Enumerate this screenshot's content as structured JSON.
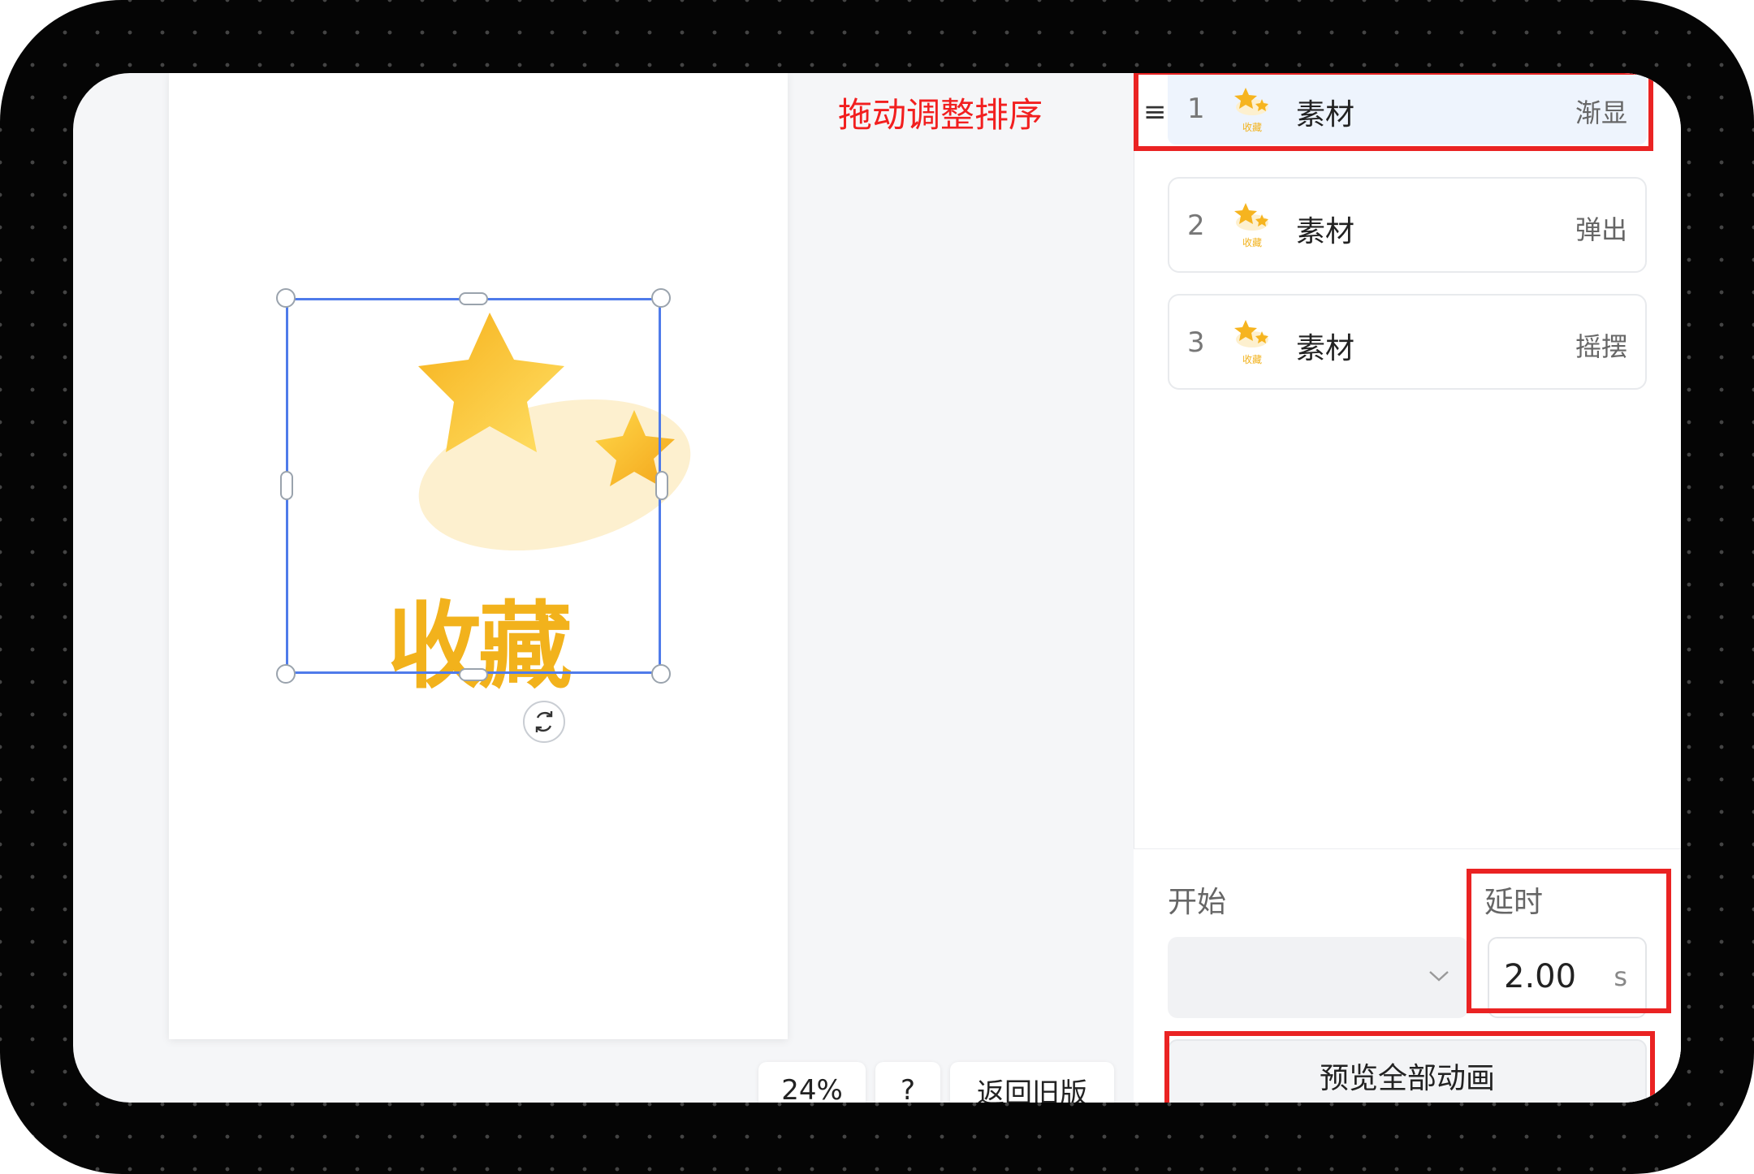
{
  "canvas": {
    "sticker_text": "收藏",
    "drag_hint": "拖动调整排序"
  },
  "toolbar": {
    "zoom": "24%",
    "help": "?",
    "back_old": "返回旧版"
  },
  "panel": {
    "items": [
      {
        "index": "1",
        "name": "素材",
        "animation": "渐显",
        "thumb_label": "收藏"
      },
      {
        "index": "2",
        "name": "素材",
        "animation": "弹出",
        "thumb_label": "收藏"
      },
      {
        "index": "3",
        "name": "素材",
        "animation": "摇摆",
        "thumb_label": "收藏"
      }
    ],
    "start_label": "开始",
    "delay_label": "延时",
    "delay_value": "2.00",
    "delay_unit": "s",
    "preview_label": "预览全部动画"
  },
  "colors": {
    "accent_blue": "#4f7bea",
    "annotation_red": "#ea2323",
    "sticker_gold": "#f2b21c"
  }
}
